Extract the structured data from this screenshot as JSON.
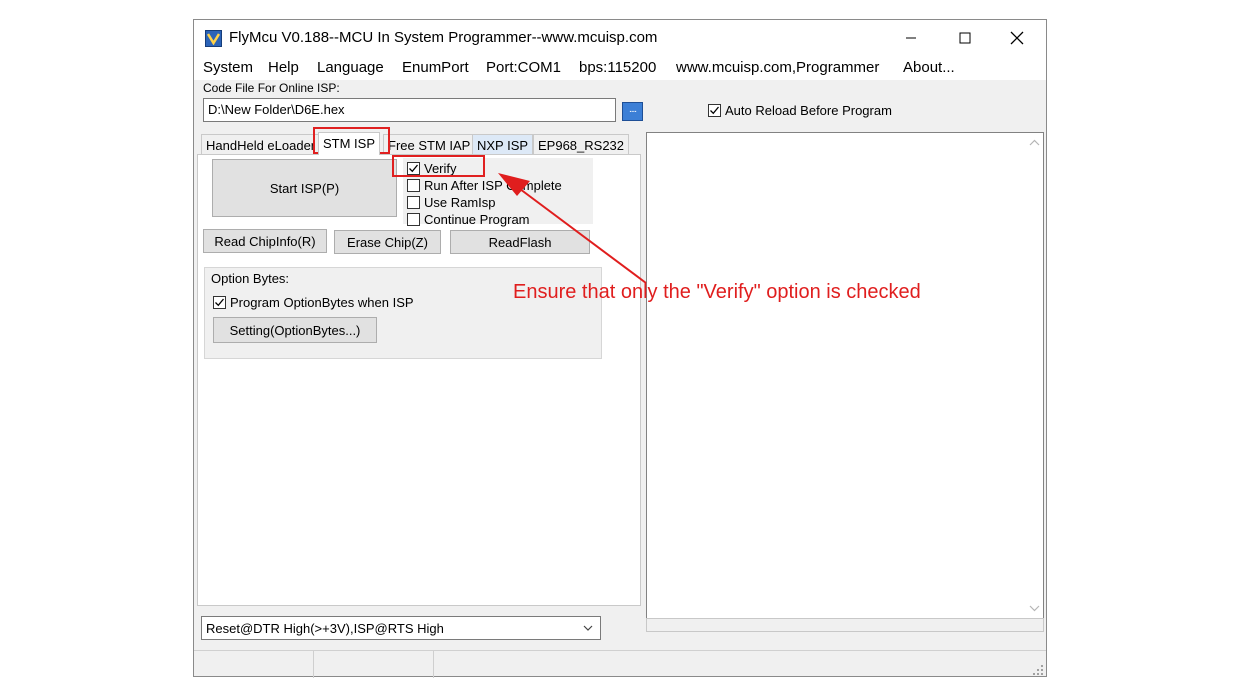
{
  "window": {
    "title": "FlyMcu V0.188--MCU In System Programmer--www.mcuisp.com",
    "controls": {
      "minimize": "—",
      "maximize": "☐",
      "close": "✕"
    }
  },
  "menu": {
    "items": [
      {
        "label": "System"
      },
      {
        "label": "Help"
      },
      {
        "label": "Language"
      },
      {
        "label": "EnumPort"
      },
      {
        "label": "Port:COM1"
      },
      {
        "label": "bps:115200"
      },
      {
        "label": "www.mcuisp.com,Programmer"
      },
      {
        "label": "About..."
      }
    ]
  },
  "code_file": {
    "label": "Code File For Online ISP:",
    "path": "D:\\New Folder\\D6E.hex",
    "browse_label": "....",
    "auto_reload_label": "Auto Reload Before Program",
    "auto_reload_checked": true
  },
  "tabs": [
    {
      "label": "HandHeld eLoader"
    },
    {
      "label": "STM ISP"
    },
    {
      "label": "Free STM IAP"
    },
    {
      "label": "NXP ISP"
    },
    {
      "label": "EP968_RS232"
    }
  ],
  "stm_isp": {
    "start_button": "Start ISP(P)",
    "options": [
      {
        "label": "Verify",
        "checked": true
      },
      {
        "label": "Run After ISP Complete",
        "checked": false
      },
      {
        "label": "Use RamIsp",
        "checked": false
      },
      {
        "label": "Continue Program",
        "checked": false
      }
    ],
    "read_chipinfo": "Read ChipInfo(R)",
    "erase_chip": "Erase Chip(Z)",
    "read_flash": "ReadFlash",
    "option_bytes": {
      "title": "Option Bytes:",
      "program_label": "Program OptionBytes when ISP",
      "program_checked": true,
      "setting_button": "Setting(OptionBytes...)"
    }
  },
  "reset_mode": {
    "value": "Reset@DTR High(>+3V),ISP@RTS High"
  },
  "annotation": {
    "text": "Ensure that only the \"Verify\" option is checked",
    "color": "#e01e1e"
  }
}
